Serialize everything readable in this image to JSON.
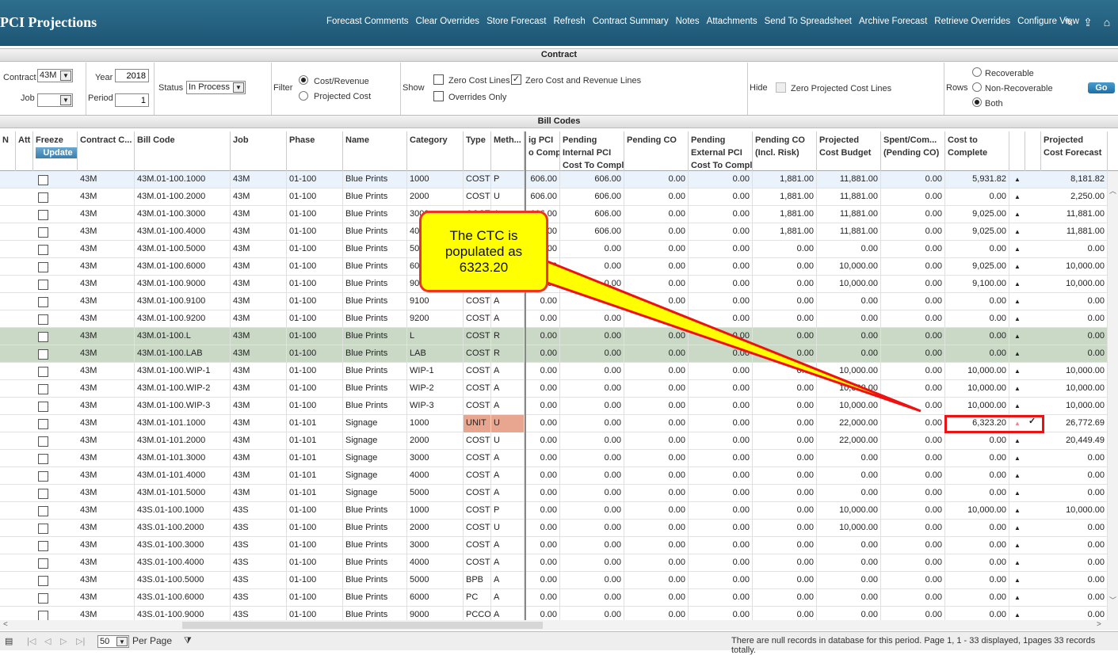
{
  "app": {
    "title": "PCI Projections"
  },
  "menu": [
    "Forecast Comments",
    "Clear Overrides",
    "Store Forecast",
    "Refresh",
    "Contract Summary",
    "Notes",
    "Attachments",
    "Send To Spreadsheet",
    "Archive Forecast",
    "Retrieve Overrides",
    "Configure View"
  ],
  "sections": {
    "contract": "Contract",
    "bill_codes": "Bill Codes"
  },
  "filters": {
    "contract_label": "Contract",
    "contract_value": "43M",
    "job_label": "Job",
    "job_value": "",
    "year_label": "Year",
    "year_value": "2018",
    "period_label": "Period",
    "period_value": "1",
    "status_label": "Status",
    "status_value": "In Process",
    "filter_label": "Filter",
    "filter_opt1": "Cost/Revenue",
    "filter_opt2": "Projected Cost",
    "show_label": "Show",
    "show_opt1": "Zero Cost Lines",
    "show_opt2": "Zero Cost and Revenue Lines",
    "show_opt3": "Overrides Only",
    "hide_label": "Hide",
    "hide_opt1": "Zero Projected Cost Lines",
    "rows_label": "Rows",
    "rows_opt1": "Recoverable",
    "rows_opt2": "Non-Recoverable",
    "rows_opt3": "Both",
    "go": "Go"
  },
  "headers": {
    "n": "N",
    "att": "Att",
    "freeze": "Freeze",
    "update": "Update",
    "contract": "Contract C...",
    "bill_code": "Bill Code",
    "job": "Job",
    "phase": "Phase",
    "name": "Name",
    "category": "Category",
    "type": "Type",
    "method": "Meth...",
    "c1a": "ig PCI",
    "c1b": "o Compl",
    "c2a": "Pending",
    "c2b": "Internal PCI",
    "c2c": "Cost To Compl",
    "c3a": "Pending CO",
    "c4a": "Pending",
    "c4b": "External PCI",
    "c4c": "Cost To Compl",
    "c5a": "Pending CO",
    "c5b": "(Incl. Risk)",
    "c6a": "Projected",
    "c6b": "Cost Budget",
    "c7a": "Spent/Com...",
    "c7b": "(Pending CO)",
    "c8a": "Cost to",
    "c8b": "Complete",
    "c9a": "Projected",
    "c9b": "Cost Forecast"
  },
  "rows": [
    [
      "43M",
      "43M.01-100.1000",
      "43M",
      "01-100",
      "Blue Prints",
      "1000",
      "COST",
      "P",
      "606.00",
      "606.00",
      "0.00",
      "0.00",
      "1,881.00",
      "11,881.00",
      "0.00",
      "5,931.82",
      "8,181.82"
    ],
    [
      "43M",
      "43M.01-100.2000",
      "43M",
      "01-100",
      "Blue Prints",
      "2000",
      "COST",
      "U",
      "606.00",
      "606.00",
      "0.00",
      "0.00",
      "1,881.00",
      "11,881.00",
      "0.00",
      "0.00",
      "2,250.00"
    ],
    [
      "43M",
      "43M.01-100.3000",
      "43M",
      "01-100",
      "Blue Prints",
      "3000",
      "COST",
      "A",
      "606.00",
      "606.00",
      "0.00",
      "0.00",
      "1,881.00",
      "11,881.00",
      "0.00",
      "9,025.00",
      "11,881.00"
    ],
    [
      "43M",
      "43M.01-100.4000",
      "43M",
      "01-100",
      "Blue Prints",
      "4000",
      "COST",
      "A",
      "606.00",
      "606.00",
      "0.00",
      "0.00",
      "1,881.00",
      "11,881.00",
      "0.00",
      "9,025.00",
      "11,881.00"
    ],
    [
      "43M",
      "43M.01-100.5000",
      "43M",
      "01-100",
      "Blue Prints",
      "5000",
      "COST",
      "A",
      "0.00",
      "0.00",
      "0.00",
      "0.00",
      "0.00",
      "0.00",
      "0.00",
      "0.00",
      "0.00"
    ],
    [
      "43M",
      "43M.01-100.6000",
      "43M",
      "01-100",
      "Blue Prints",
      "6000",
      "COST",
      "A",
      "0.00",
      "0.00",
      "0.00",
      "0.00",
      "0.00",
      "10,000.00",
      "0.00",
      "9,025.00",
      "10,000.00"
    ],
    [
      "43M",
      "43M.01-100.9000",
      "43M",
      "01-100",
      "Blue Prints",
      "9000",
      "COST",
      "A",
      "0.00",
      "0.00",
      "0.00",
      "0.00",
      "0.00",
      "10,000.00",
      "0.00",
      "9,100.00",
      "10,000.00"
    ],
    [
      "43M",
      "43M.01-100.9100",
      "43M",
      "01-100",
      "Blue Prints",
      "9100",
      "COST",
      "A",
      "0.00",
      "0.00",
      "0.00",
      "0.00",
      "0.00",
      "0.00",
      "0.00",
      "0.00",
      "0.00"
    ],
    [
      "43M",
      "43M.01-100.9200",
      "43M",
      "01-100",
      "Blue Prints",
      "9200",
      "COST",
      "A",
      "0.00",
      "0.00",
      "0.00",
      "0.00",
      "0.00",
      "0.00",
      "0.00",
      "0.00",
      "0.00"
    ],
    [
      "43M",
      "43M.01-100.L",
      "43M",
      "01-100",
      "Blue Prints",
      "L",
      "COST",
      "R",
      "0.00",
      "0.00",
      "0.00",
      "0.00",
      "0.00",
      "0.00",
      "0.00",
      "0.00",
      "0.00"
    ],
    [
      "43M",
      "43M.01-100.LAB",
      "43M",
      "01-100",
      "Blue Prints",
      "LAB",
      "COST",
      "R",
      "0.00",
      "0.00",
      "0.00",
      "0.00",
      "0.00",
      "0.00",
      "0.00",
      "0.00",
      "0.00"
    ],
    [
      "43M",
      "43M.01-100.WIP-1",
      "43M",
      "01-100",
      "Blue Prints",
      "WIP-1",
      "COST",
      "A",
      "0.00",
      "0.00",
      "0.00",
      "0.00",
      "0.00",
      "10,000.00",
      "0.00",
      "10,000.00",
      "10,000.00"
    ],
    [
      "43M",
      "43M.01-100.WIP-2",
      "43M",
      "01-100",
      "Blue Prints",
      "WIP-2",
      "COST",
      "A",
      "0.00",
      "0.00",
      "0.00",
      "0.00",
      "0.00",
      "10,000.00",
      "0.00",
      "10,000.00",
      "10,000.00"
    ],
    [
      "43M",
      "43M.01-100.WIP-3",
      "43M",
      "01-100",
      "Blue Prints",
      "WIP-3",
      "COST",
      "A",
      "0.00",
      "0.00",
      "0.00",
      "0.00",
      "0.00",
      "10,000.00",
      "0.00",
      "10,000.00",
      "10,000.00"
    ],
    [
      "43M",
      "43M.01-101.1000",
      "43M",
      "01-101",
      "Signage",
      "1000",
      "UNIT",
      "U",
      "0.00",
      "0.00",
      "0.00",
      "0.00",
      "0.00",
      "22,000.00",
      "0.00",
      "6,323.20",
      "26,772.69"
    ],
    [
      "43M",
      "43M.01-101.2000",
      "43M",
      "01-101",
      "Signage",
      "2000",
      "COST",
      "U",
      "0.00",
      "0.00",
      "0.00",
      "0.00",
      "0.00",
      "22,000.00",
      "0.00",
      "0.00",
      "20,449.49"
    ],
    [
      "43M",
      "43M.01-101.3000",
      "43M",
      "01-101",
      "Signage",
      "3000",
      "COST",
      "A",
      "0.00",
      "0.00",
      "0.00",
      "0.00",
      "0.00",
      "0.00",
      "0.00",
      "0.00",
      "0.00"
    ],
    [
      "43M",
      "43M.01-101.4000",
      "43M",
      "01-101",
      "Signage",
      "4000",
      "COST",
      "A",
      "0.00",
      "0.00",
      "0.00",
      "0.00",
      "0.00",
      "0.00",
      "0.00",
      "0.00",
      "0.00"
    ],
    [
      "43M",
      "43M.01-101.5000",
      "43M",
      "01-101",
      "Signage",
      "5000",
      "COST",
      "A",
      "0.00",
      "0.00",
      "0.00",
      "0.00",
      "0.00",
      "0.00",
      "0.00",
      "0.00",
      "0.00"
    ],
    [
      "43M",
      "43S.01-100.1000",
      "43S",
      "01-100",
      "Blue Prints",
      "1000",
      "COST",
      "P",
      "0.00",
      "0.00",
      "0.00",
      "0.00",
      "0.00",
      "10,000.00",
      "0.00",
      "10,000.00",
      "10,000.00"
    ],
    [
      "43M",
      "43S.01-100.2000",
      "43S",
      "01-100",
      "Blue Prints",
      "2000",
      "COST",
      "U",
      "0.00",
      "0.00",
      "0.00",
      "0.00",
      "0.00",
      "10,000.00",
      "0.00",
      "0.00",
      "0.00"
    ],
    [
      "43M",
      "43S.01-100.3000",
      "43S",
      "01-100",
      "Blue Prints",
      "3000",
      "COST",
      "A",
      "0.00",
      "0.00",
      "0.00",
      "0.00",
      "0.00",
      "0.00",
      "0.00",
      "0.00",
      "0.00"
    ],
    [
      "43M",
      "43S.01-100.4000",
      "43S",
      "01-100",
      "Blue Prints",
      "4000",
      "COST",
      "A",
      "0.00",
      "0.00",
      "0.00",
      "0.00",
      "0.00",
      "0.00",
      "0.00",
      "0.00",
      "0.00"
    ],
    [
      "43M",
      "43S.01-100.5000",
      "43S",
      "01-100",
      "Blue Prints",
      "5000",
      "BPB",
      "A",
      "0.00",
      "0.00",
      "0.00",
      "0.00",
      "0.00",
      "0.00",
      "0.00",
      "0.00",
      "0.00"
    ],
    [
      "43M",
      "43S.01-100.6000",
      "43S",
      "01-100",
      "Blue Prints",
      "6000",
      "PC",
      "A",
      "0.00",
      "0.00",
      "0.00",
      "0.00",
      "0.00",
      "0.00",
      "0.00",
      "0.00",
      "0.00"
    ],
    [
      "43M",
      "43S.01-100.9000",
      "43S",
      "01-100",
      "Blue Prints",
      "9000",
      "PCCO",
      "A",
      "0.00",
      "0.00",
      "0.00",
      "0.00",
      "0.00",
      "0.00",
      "0.00",
      "0.00",
      "0.00"
    ]
  ],
  "callout": {
    "text": "The CTC is populated as 6323.20"
  },
  "status": {
    "page_size": "50",
    "per_page": "Per Page",
    "message": "There are null records in database for this period.  Page 1, 1 - 33 displayed, 1pages 33 records totally."
  },
  "colors": {
    "header_bg": "#2e6f8e",
    "selected_row": "#e8f2fb",
    "green_row": "#c9d9c6",
    "unit_cell": "#e8a58f",
    "callout_bg": "#ffff00",
    "callout_border": "#e33322"
  }
}
